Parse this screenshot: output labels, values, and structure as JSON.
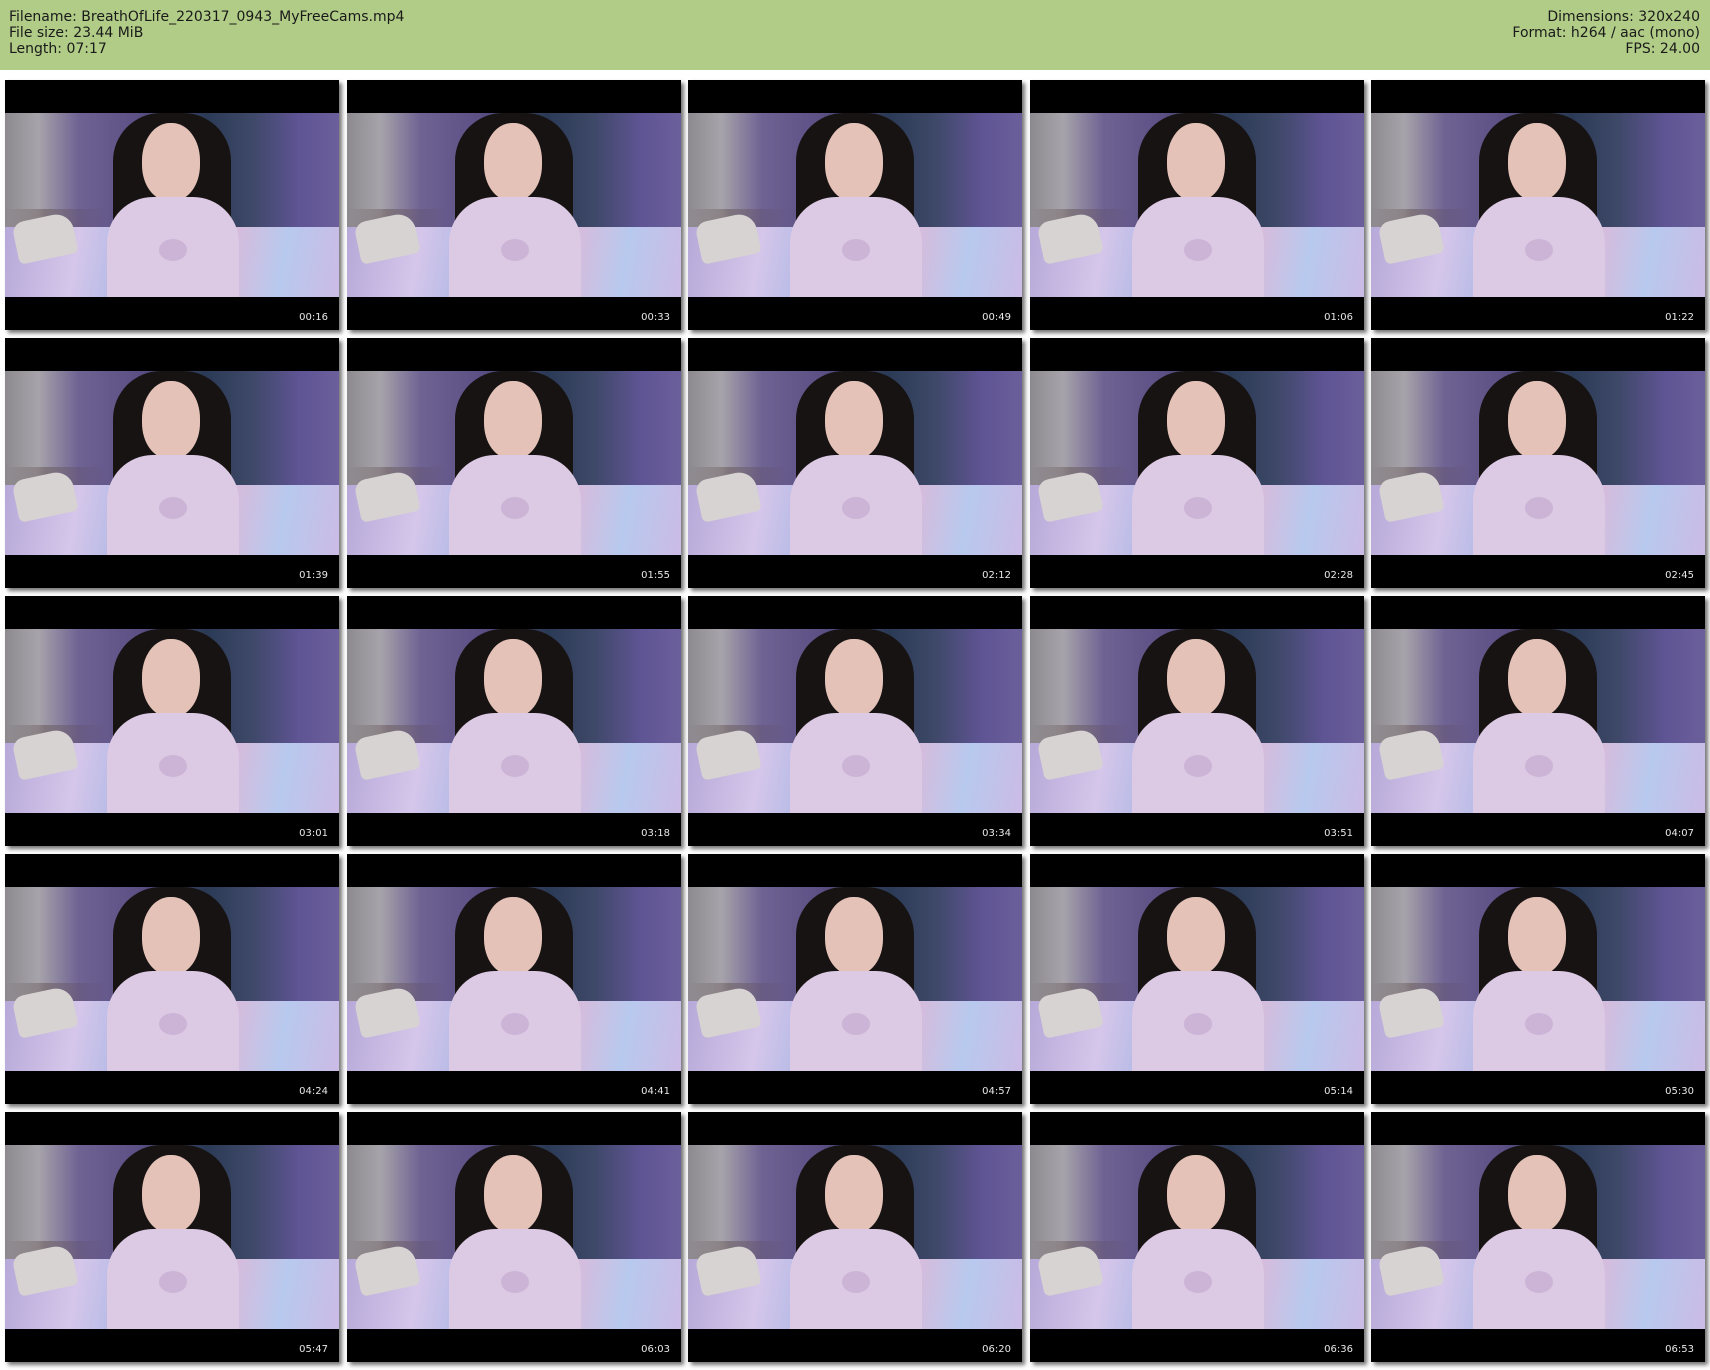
{
  "header": {
    "filename": "Filename: BreathOfLife_220317_0943_MyFreeCams.mp4",
    "filesize": "File size: 23.44 MiB",
    "length": "Length: 07:17",
    "dimensions": "Dimensions: 320x240",
    "format": "Format: h264 / aac (mono)",
    "fps": "FPS: 24.00"
  },
  "colors": {
    "header_bg": "#b0cc86",
    "page_bg": "#ffffff"
  },
  "thumbnails": [
    {
      "timestamp": "00:16"
    },
    {
      "timestamp": "00:33"
    },
    {
      "timestamp": "00:49"
    },
    {
      "timestamp": "01:06"
    },
    {
      "timestamp": "01:22"
    },
    {
      "timestamp": "01:39"
    },
    {
      "timestamp": "01:55"
    },
    {
      "timestamp": "02:12"
    },
    {
      "timestamp": "02:28"
    },
    {
      "timestamp": "02:45"
    },
    {
      "timestamp": "03:01"
    },
    {
      "timestamp": "03:18"
    },
    {
      "timestamp": "03:34"
    },
    {
      "timestamp": "03:51"
    },
    {
      "timestamp": "04:07"
    },
    {
      "timestamp": "04:24"
    },
    {
      "timestamp": "04:41"
    },
    {
      "timestamp": "04:57"
    },
    {
      "timestamp": "05:14"
    },
    {
      "timestamp": "05:30"
    },
    {
      "timestamp": "05:47"
    },
    {
      "timestamp": "06:03"
    },
    {
      "timestamp": "06:20"
    },
    {
      "timestamp": "06:36"
    },
    {
      "timestamp": "06:53"
    }
  ]
}
